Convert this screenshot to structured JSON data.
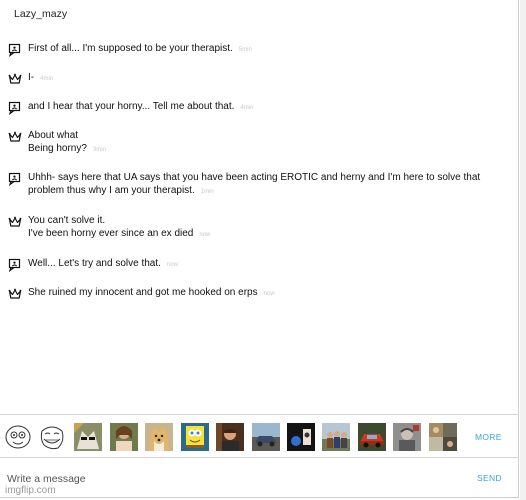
{
  "chat": {
    "contact_name": "Lazy_mazy",
    "messages": [
      {
        "sender": "therapist",
        "avatar_icon": "chat-bubble-icon",
        "lines": [
          "First of all... I'm supposed to be your therapist."
        ],
        "time": "5min"
      },
      {
        "sender": "user",
        "avatar_icon": "crown-icon",
        "lines": [
          "I-"
        ],
        "time": "4min"
      },
      {
        "sender": "therapist",
        "avatar_icon": "chat-bubble-icon",
        "lines": [
          "and I hear that your horny... Tell me about that."
        ],
        "time": "4min"
      },
      {
        "sender": "user",
        "avatar_icon": "crown-icon",
        "lines": [
          "About what",
          "Being horny?"
        ],
        "time": "3min"
      },
      {
        "sender": "therapist",
        "avatar_icon": "chat-bubble-icon",
        "lines": [
          "Uhhh- says here that UA says that you have been acting EROTIC and herny and I'm here to solve that",
          "problem thus why I am your therapist."
        ],
        "time": "1min"
      },
      {
        "sender": "user",
        "avatar_icon": "crown-icon",
        "lines": [
          "You can't solve it.",
          "I've been horny ever since an ex died"
        ],
        "time": "now"
      },
      {
        "sender": "therapist",
        "avatar_icon": "chat-bubble-icon",
        "lines": [
          "Well... Let's try and solve that."
        ],
        "time": "now"
      },
      {
        "sender": "user",
        "avatar_icon": "crown-icon",
        "lines": [
          "She ruined my innocent and got me hooked on erps"
        ],
        "time": "now"
      }
    ]
  },
  "stickers": {
    "items": [
      {
        "name": "rage-face-sticker"
      },
      {
        "name": "troll-face-sticker"
      },
      {
        "name": "cat-sticker"
      },
      {
        "name": "woman-photo-sticker"
      },
      {
        "name": "doge-sticker"
      },
      {
        "name": "spongebob-sticker"
      },
      {
        "name": "man-photo-sticker"
      },
      {
        "name": "car-photo-sticker"
      },
      {
        "name": "dark-photo-sticker"
      },
      {
        "name": "group-photo-sticker"
      },
      {
        "name": "red-car-sticker"
      },
      {
        "name": "grey-photo-sticker"
      },
      {
        "name": "collage-sticker"
      }
    ],
    "more_label": "MORE"
  },
  "composer": {
    "placeholder": "Write a message",
    "send_label": "SEND"
  },
  "watermark": "imgflip.com",
  "colors": {
    "accent": "#3aa4d8",
    "timestamp": "#c9c9c9",
    "divider": "#d6d6d6"
  }
}
